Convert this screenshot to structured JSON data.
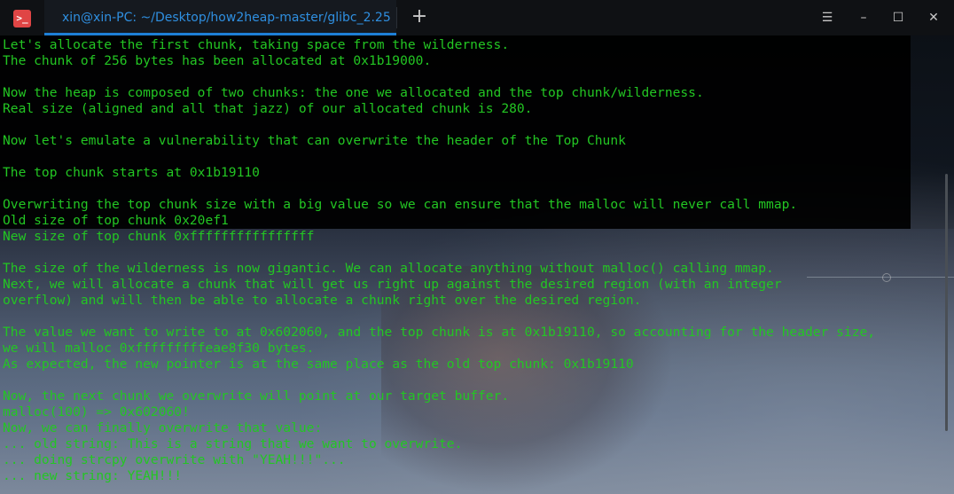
{
  "app": {
    "icon_glyph": ">_",
    "tab_title": "xin@xin-PC: ~/Desktop/how2heap-master/glibc_2.25",
    "new_tab_glyph": "+",
    "controls": {
      "menu": "☰",
      "minimize": "–",
      "maximize": "☐",
      "close": "✕"
    }
  },
  "colors": {
    "terminal_text": "#23c623",
    "accent": "#1e7fd6",
    "app_icon": "#e04545"
  },
  "terminal": {
    "lines": [
      "Let's allocate the first chunk, taking space from the wilderness.",
      "The chunk of 256 bytes has been allocated at 0x1b19000.",
      "",
      "Now the heap is composed of two chunks: the one we allocated and the top chunk/wilderness.",
      "Real size (aligned and all that jazz) of our allocated chunk is 280.",
      "",
      "Now let's emulate a vulnerability that can overwrite the header of the Top Chunk",
      "",
      "The top chunk starts at 0x1b19110",
      "",
      "Overwriting the top chunk size with a big value so we can ensure that the malloc will never call mmap.",
      "Old size of top chunk 0x20ef1",
      "New size of top chunk 0xffffffffffffffff",
      "",
      "The size of the wilderness is now gigantic. We can allocate anything without malloc() calling mmap.",
      "Next, we will allocate a chunk that will get us right up against the desired region (with an integer",
      "overflow) and will then be able to allocate a chunk right over the desired region.",
      "",
      "The value we want to write to at 0x602060, and the top chunk is at 0x1b19110, so accounting for the header size,",
      "we will malloc 0xfffffffffeae8f30 bytes.",
      "As expected, the new pointer is at the same place as the old top chunk: 0x1b19110",
      "",
      "Now, the next chunk we overwrite will point at our target buffer.",
      "malloc(100) => 0x602060!",
      "Now, we can finally overwrite that value:",
      "... old string: This is a string that we want to overwrite.",
      "... doing strcpy overwrite with \"YEAH!!!\"...",
      "... new string: YEAH!!!"
    ]
  }
}
